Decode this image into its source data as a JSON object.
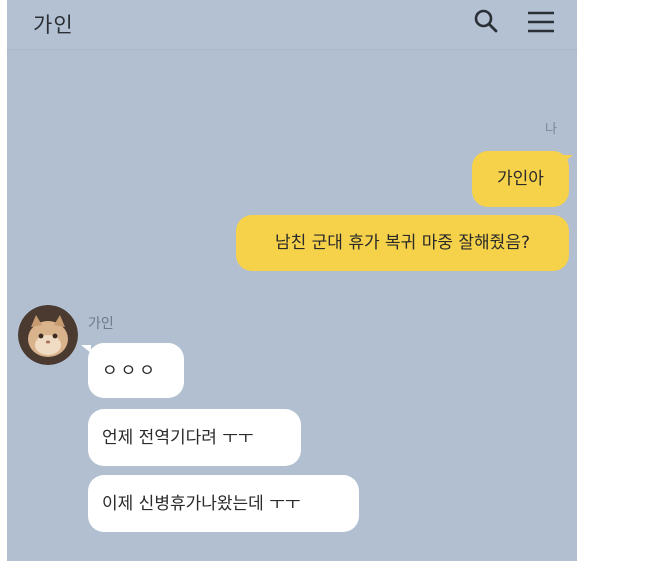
{
  "header": {
    "title": "가인",
    "search_icon": "search-icon",
    "menu_icon": "menu-icon"
  },
  "messages_out": {
    "sender_label": "나",
    "items": [
      "가인아",
      "남친 군대 휴가 복귀 마중 잘해줬음?"
    ]
  },
  "messages_in": {
    "sender_name": "가인",
    "avatar_icon": "avatar-cat",
    "items": [
      "ㅇㅇㅇ",
      "언제 전역기다려 ㅜㅜ",
      "이제 신병휴가나왔는데 ㅜㅜ"
    ]
  },
  "colors": {
    "background": "#b1bfd1",
    "outgoing_bubble": "#f5d24a",
    "incoming_bubble": "#ffffff"
  }
}
